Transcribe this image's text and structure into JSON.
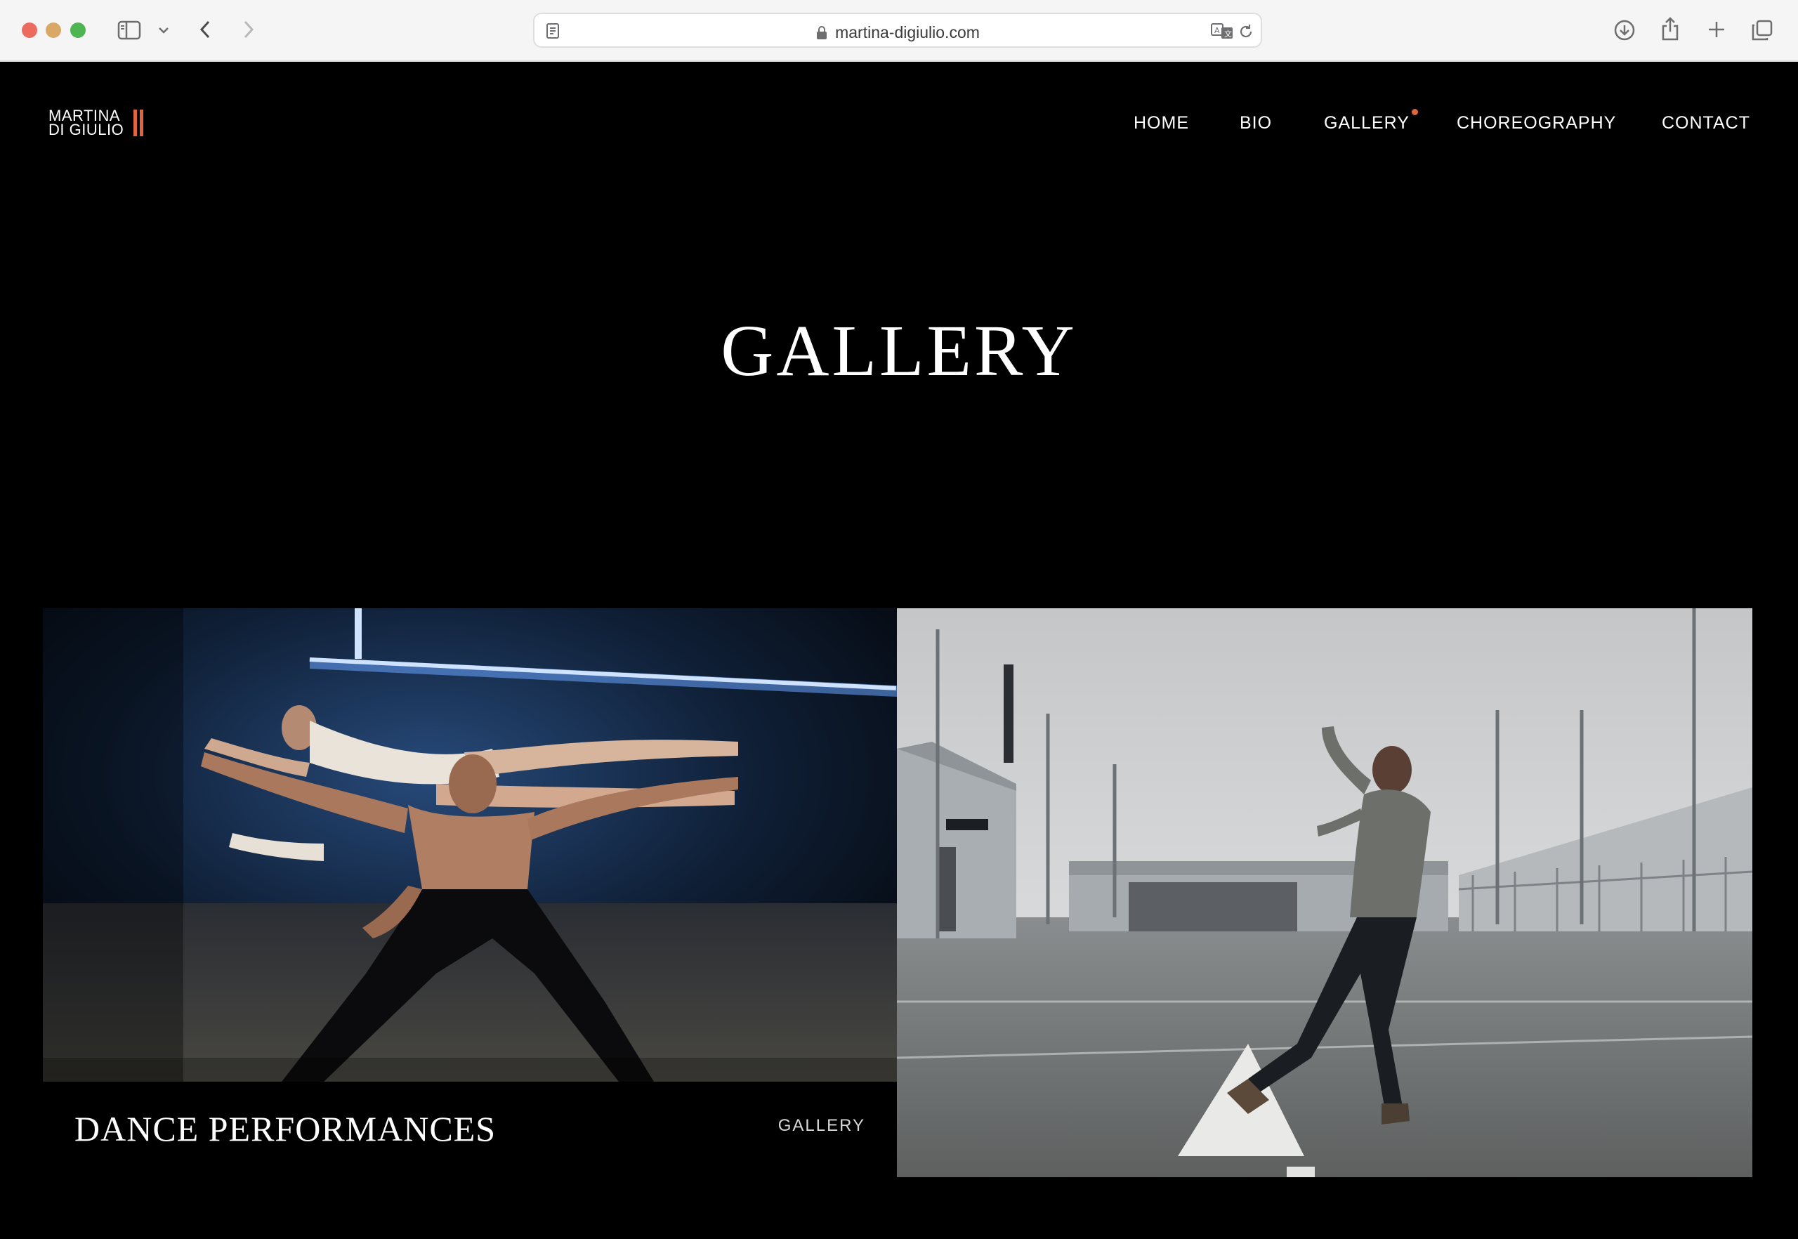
{
  "browser": {
    "url": "martina-digiulio.com"
  },
  "site": {
    "logo": {
      "line1": "MARTINA",
      "line2": "DI GIULIO",
      "accent_color": "#e0663f"
    },
    "nav": {
      "home": "HOME",
      "bio": "BIO",
      "gallery": "GALLERY",
      "choreography": "CHOREOGRAPHY",
      "contact": "CONTACT",
      "active": "GALLERY"
    },
    "page_title": "GALLERY",
    "gallery_items": [
      {
        "title": "DANCE PERFORMANCES",
        "tag": "GALLERY"
      },
      {
        "title": "",
        "tag": ""
      }
    ]
  }
}
